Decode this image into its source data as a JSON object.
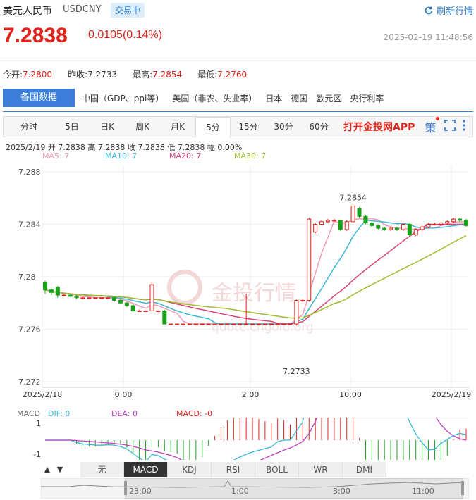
{
  "header": {
    "name": "美元人民币",
    "code": "USDCNY",
    "status": "交易中",
    "refresh_label": "刷新行情"
  },
  "price": {
    "last": "7.2838",
    "change": "0.0105(0.14%)",
    "timestamp": "2025-02-19 11:48:56"
  },
  "quote": {
    "open_label": "今开:",
    "open": "7.2800",
    "prev_label": "昨收:",
    "prev": "7.2733",
    "high_label": "最高:",
    "high": "7.2854",
    "low_label": "最低:",
    "low": "7.2760"
  },
  "nav": {
    "title": "各国数据",
    "items": [
      "中国（GDP、ppi等）",
      "美国（非农、失业率）",
      "日本",
      "德国",
      "欧元区",
      "央行利率"
    ]
  },
  "tabs": {
    "items": [
      "分时",
      "5日",
      "日K",
      "周K",
      "月K",
      "5分",
      "15分",
      "30分",
      "60分"
    ],
    "active": "5分",
    "app_link": "打开金投网APP",
    "strategy_icon": "策"
  },
  "info": {
    "date": "2025/2/19",
    "open_label": "开",
    "open": "7.2838",
    "high_label": "高",
    "high": "7.2838",
    "close_label": "收",
    "close": "7.2838",
    "low_label": "低",
    "low": "7.2838",
    "amp_label": "幅",
    "amp": "0.00%"
  },
  "ma": [
    {
      "label": "MA5: 7",
      "color": "#f29bb3"
    },
    {
      "label": "MA10: 7",
      "color": "#3ab8d6"
    },
    {
      "label": "MA20: 7",
      "color": "#d9427c"
    },
    {
      "label": "MA30: 7",
      "color": "#9cbd2c"
    }
  ],
  "chart_data": {
    "type": "candlestick",
    "y_ticks": [
      "7.288",
      "7.284",
      "7.28",
      "7.276",
      "7.272"
    ],
    "ylim": [
      7.272,
      7.288
    ],
    "x_ticks": [
      "2025/2/18",
      "0:00",
      "2:00",
      "10:00",
      "2025/2/19"
    ],
    "annotations": [
      {
        "label": "7.2854",
        "value": 7.2854
      },
      {
        "label": "7.2733",
        "value": 7.2733
      }
    ],
    "watermark": "金投行情",
    "watermark_url": "quote.cngold.org"
  },
  "macd": {
    "label": "MACD",
    "dif": "DIF: 0",
    "dea": "DEA: 0",
    "macd": "MACD: -0",
    "y_ticks": [
      "1",
      "-1"
    ]
  },
  "indicators": {
    "items": [
      "无",
      "MACD",
      "KDJ",
      "RSI",
      "BOLL",
      "WR",
      "DMI"
    ],
    "active": "MACD"
  },
  "navigator": {
    "ticks": [
      "23:00",
      "1:00",
      "3:00",
      "11:00"
    ]
  }
}
